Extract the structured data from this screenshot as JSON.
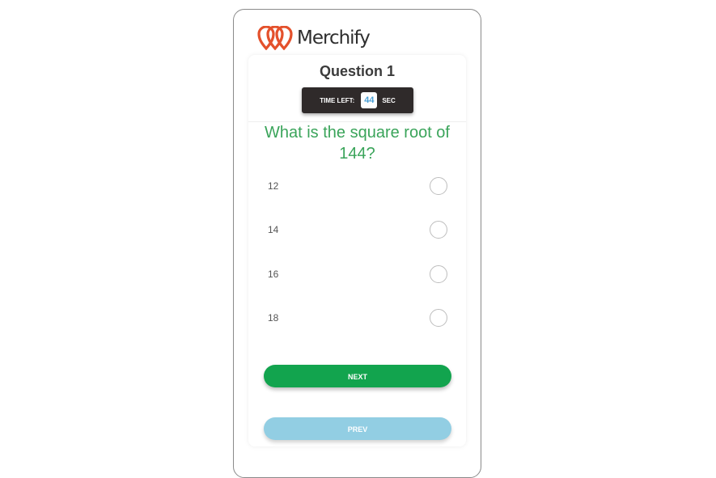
{
  "brand": {
    "name": "Merchify",
    "accent": "#e4512c"
  },
  "quiz": {
    "question_title": "Question 1",
    "timer_label": "TIME LEFT:",
    "timer_value": "44",
    "timer_unit": "SEC",
    "question_text": "What is the square root of 144?",
    "question_color": "#3aa45a",
    "options": [
      {
        "label": "12",
        "selected": false
      },
      {
        "label": "14",
        "selected": false
      },
      {
        "label": "16",
        "selected": false
      },
      {
        "label": "18",
        "selected": false
      }
    ],
    "next_label": "NEXT",
    "prev_label": "PREV",
    "next_color": "#12a44e",
    "prev_color": "#92cee3"
  }
}
